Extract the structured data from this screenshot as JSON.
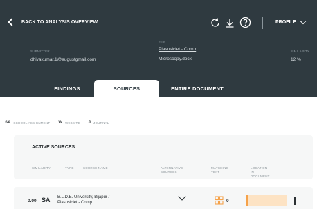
{
  "header": {
    "back_label": "BACK TO ANALYSIS OVERVIEW",
    "profile_label": "PROFILE",
    "submitter_label": "SUBMITTER",
    "submitter_value": "dhivakumar.1@augustgmail.com",
    "file_label": "FILE",
    "file_value_1": "Plasusiclet - Comp",
    "file_value_2": "Microscopy.docx",
    "similarity_label": "SIMILARITY",
    "similarity_value": "12 %"
  },
  "tabs": [
    {
      "label": "FINDINGS",
      "active": false
    },
    {
      "label": "SOURCES",
      "active": true
    },
    {
      "label": "ENTIRE DOCUMENT",
      "active": false
    }
  ],
  "legend": [
    {
      "code": "SA",
      "name": "SCHOOL ASSIGNMENT"
    },
    {
      "code": "W",
      "name": "WEBSITE"
    },
    {
      "code": "J",
      "name": "JOURNAL"
    }
  ],
  "active_sources": {
    "title": "ACTIVE SOURCES",
    "columns": {
      "similarity": "SIMILARITY",
      "type": "TYPE",
      "source_name": "SOURCE NAME",
      "alternative_1": "ALTERNATIVE",
      "alternative_2": "SOURCES",
      "matching_1": "MATCHING",
      "matching_2": "TEXT",
      "location_1": "LOCATION",
      "location_2": "IN",
      "location_3": "DOCUMENT"
    },
    "rows": [
      {
        "similarity": "0.00",
        "type": "SA",
        "source_line_1": "B.L.D.E. University, Bijapur /",
        "source_line_2": "Plasusiclet - Comp",
        "matching_count": "0"
      }
    ]
  },
  "colors": {
    "header_bg": "#2f3a40",
    "accent": "#f5a24a",
    "card_bg": "#f6f7f7"
  },
  "icons": [
    "chevron-left-icon",
    "refresh-icon",
    "download-icon",
    "help-icon",
    "chevron-down-icon",
    "match-grid-icon"
  ]
}
